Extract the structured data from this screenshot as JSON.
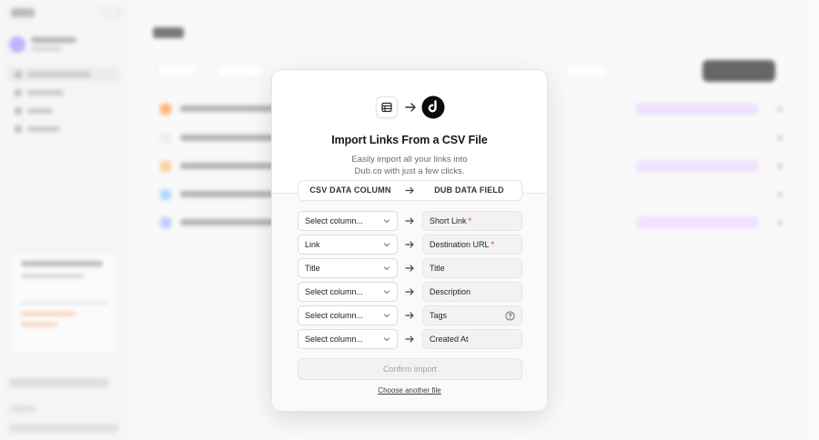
{
  "modal": {
    "title": "Import Links From a CSV File",
    "subtitle": "Easily import all your links into Dub.co with just a few clicks.",
    "icons": [
      "table-icon",
      "arrow-right-icon",
      "dub-logo-icon"
    ],
    "mapping_header": {
      "left": "CSV DATA COLUMN",
      "right": "DUB DATA FIELD"
    },
    "rows": [
      {
        "select_value": "Select column...",
        "field": "Short Link",
        "required": "*",
        "help": ""
      },
      {
        "select_value": "Link",
        "field": "Destination URL",
        "required": "*",
        "help": ""
      },
      {
        "select_value": "Title",
        "field": "Title",
        "required": "",
        "help": ""
      },
      {
        "select_value": "Select column...",
        "field": "Description",
        "required": "",
        "help": ""
      },
      {
        "select_value": "Select column...",
        "field": "Tags",
        "required": "",
        "help": "question-circle-icon"
      },
      {
        "select_value": "Select column...",
        "field": "Created At",
        "required": "",
        "help": ""
      }
    ],
    "confirm_label": "Confirm import",
    "choose_another_label": "Choose another file"
  },
  "colors": {
    "required": "#dc2626",
    "primary_text": "#171717",
    "muted_text": "#6b6b6b",
    "disabled_text": "#a3a3a3",
    "field_bg": "#f2f2f2"
  }
}
